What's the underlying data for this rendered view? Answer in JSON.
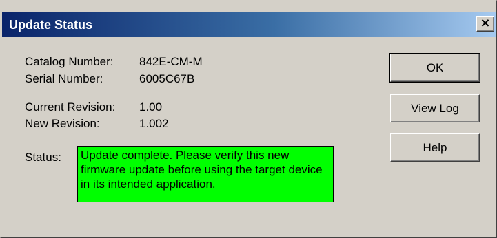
{
  "window": {
    "title": "Update Status",
    "close_symbol": "×"
  },
  "info": {
    "catalog_label": "Catalog Number:",
    "catalog_value": "842E-CM-M",
    "serial_label": "Serial Number:",
    "serial_value": "6005C67B",
    "current_rev_label": "Current Revision:",
    "current_rev_value": "1.00",
    "new_rev_label": "New Revision:",
    "new_rev_value": "1.002",
    "status_label": "Status:",
    "status_text": "Update complete. Please verify this new firmware update before using the target device in its intended application."
  },
  "buttons": {
    "ok": "OK",
    "view_log": "View Log",
    "help": "Help"
  },
  "colors": {
    "status_background": "#00ff00",
    "dialog_background": "#d4d0c8",
    "title_gradient_start": "#0a246a",
    "title_gradient_end": "#a6caf0"
  }
}
